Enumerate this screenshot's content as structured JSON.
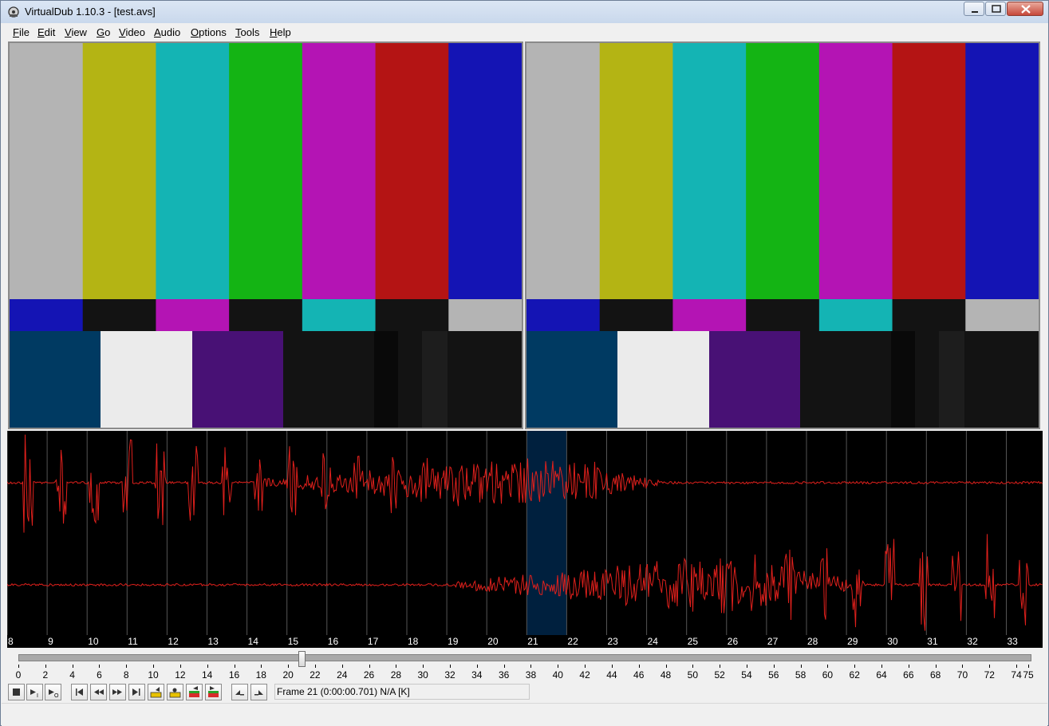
{
  "window": {
    "title": "VirtualDub 1.10.3 - [test.avs]"
  },
  "menu": [
    "File",
    "Edit",
    "View",
    "Go",
    "Video",
    "Audio",
    "Options",
    "Tools",
    "Help"
  ],
  "menu_mnemonic": [
    "F",
    "E",
    "V",
    "G",
    "V",
    "A",
    "O",
    "T",
    "H"
  ],
  "colors": {
    "bar_gray": "#b4b4b4",
    "bar_yellow": "#b4b414",
    "bar_cyan": "#14b4b4",
    "bar_green": "#14b414",
    "bar_magenta": "#b414b4",
    "bar_red": "#b41414",
    "bar_blue": "#1414b4",
    "mid_black": "#131313",
    "pluge_navy": "#003a62",
    "pluge_white": "#ebebeb",
    "pluge_purple": "#481175",
    "waveform": "#e0201c",
    "selection": "#00203e",
    "grid": "#555555"
  },
  "waveform": {
    "frame_labels": [
      "8",
      "9",
      "10",
      "11",
      "12",
      "13",
      "14",
      "15",
      "16",
      "17",
      "18",
      "19",
      "20",
      "21",
      "22",
      "23",
      "24",
      "25",
      "26",
      "27",
      "28",
      "29",
      "30",
      "31",
      "32",
      "33"
    ],
    "selected_frame": "21"
  },
  "timeline": {
    "labels": [
      "0",
      "2",
      "4",
      "6",
      "8",
      "10",
      "12",
      "14",
      "16",
      "18",
      "20",
      "22",
      "24",
      "26",
      "28",
      "30",
      "32",
      "34",
      "36",
      "38",
      "40",
      "42",
      "44",
      "46",
      "48",
      "50",
      "52",
      "54",
      "56",
      "58",
      "60",
      "62",
      "64",
      "66",
      "68",
      "70",
      "72",
      "74",
      "75"
    ],
    "current_frame": 21,
    "total_frames": 75
  },
  "toolbar": {
    "buttons": [
      "stop-icon",
      "play-input-icon",
      "play-output-icon",
      "go-start-icon",
      "prev-frame-icon",
      "next-frame-icon",
      "go-end-icon",
      "prev-keyframe-icon",
      "next-keyframe-icon",
      "prev-scene-icon",
      "next-scene-icon",
      "mark-in-icon",
      "mark-out-icon"
    ],
    "status": "Frame 21 (0:00:00.701) N/A [K]"
  }
}
